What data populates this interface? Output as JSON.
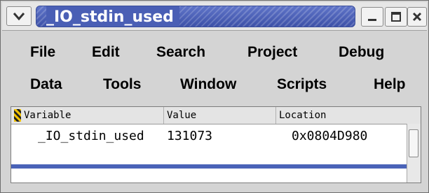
{
  "window": {
    "title": "_IO_stdin_used",
    "icons": {
      "menu": "chevron-down-icon",
      "minimize": "minimize-icon",
      "maximize": "maximize-icon",
      "close": "close-icon"
    }
  },
  "menubar": {
    "row1": [
      "File",
      "Edit",
      "Search",
      "Project",
      "Debug"
    ],
    "row2": [
      "Data",
      "Tools",
      "Window",
      "Scripts",
      "Help"
    ]
  },
  "table": {
    "columns": {
      "variable": "Variable",
      "value": "Value",
      "location": "Location"
    },
    "rows": [
      {
        "variable": "_IO_stdin_used",
        "value": "131073",
        "location": "0x0804D980"
      }
    ]
  },
  "colors": {
    "title_bar": "#4a5fb5",
    "chrome": "#d4d4d4",
    "accent_strip": "#4a63b8"
  }
}
